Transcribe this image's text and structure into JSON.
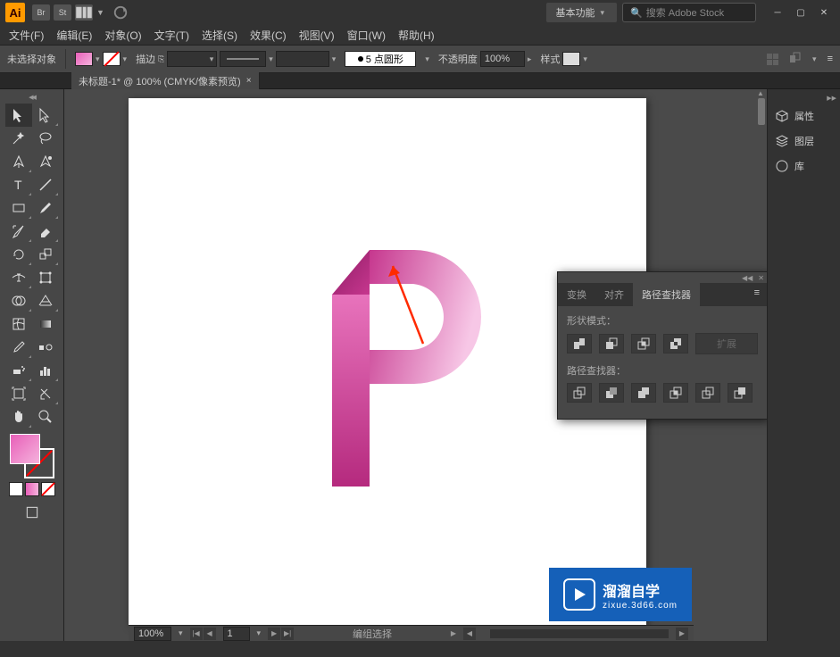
{
  "titlebar": {
    "workspace": "基本功能",
    "search_placeholder": "搜索 Adobe Stock"
  },
  "menubar": {
    "items": [
      "文件(F)",
      "编辑(E)",
      "对象(O)",
      "文字(T)",
      "选择(S)",
      "效果(C)",
      "视图(V)",
      "窗口(W)",
      "帮助(H)"
    ]
  },
  "options": {
    "selection_label": "未选择对象",
    "stroke_label": "描边",
    "variable_width": "5 点圆形",
    "opacity_label": "不透明度",
    "opacity_value": "100%",
    "style_label": "样式"
  },
  "doc_tab": {
    "title": "未标题-1* @ 100% (CMYK/像素预览)"
  },
  "right_panels": {
    "items": [
      {
        "icon": "cube",
        "label": "属性"
      },
      {
        "icon": "layers",
        "label": "图层"
      },
      {
        "icon": "cc",
        "label": "库"
      }
    ]
  },
  "pathfinder": {
    "tabs": [
      "变换",
      "对齐",
      "路径查找器"
    ],
    "shape_modes_label": "形状模式：",
    "expand_button": "扩展",
    "pathfinders_label": "路径查找器："
  },
  "statusbar": {
    "zoom": "100%",
    "page": "1",
    "mode": "编组选择"
  },
  "watermark": {
    "title": "溜溜自学",
    "url": "zixue.3d66.com"
  }
}
